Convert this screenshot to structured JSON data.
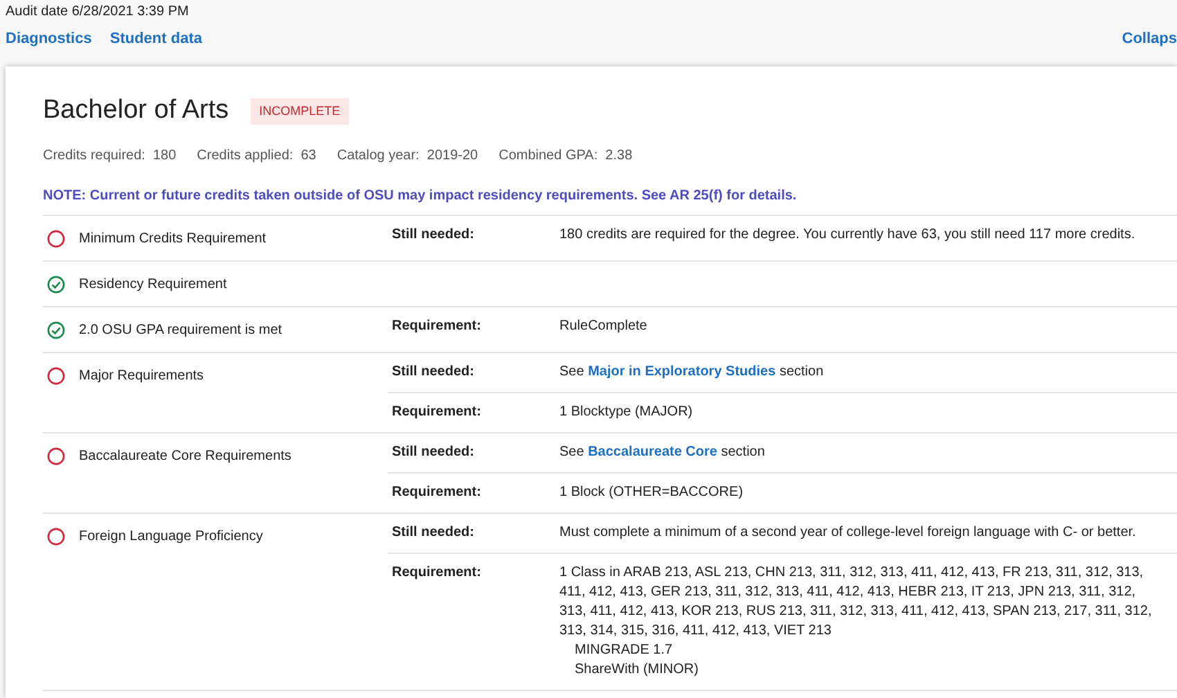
{
  "audit_date": {
    "label": "Audit date",
    "value": "6/28/2021 3:39 PM"
  },
  "links": [
    "Diagnostics",
    "Student data"
  ],
  "collapse_link": "Collaps",
  "degree": {
    "title": "Bachelor of Arts",
    "status": "INCOMPLETE"
  },
  "stats": [
    {
      "label": "Credits required:",
      "value": "180"
    },
    {
      "label": "Credits applied:",
      "value": "63"
    },
    {
      "label": "Catalog year:",
      "value": "2019-20"
    },
    {
      "label": "Combined GPA:",
      "value": "2.38"
    }
  ],
  "note": "NOTE: Current or future credits taken outside of OSU may impact residency requirements. See AR 25(f) for details.",
  "requirements": [
    {
      "name": "Minimum Credits Requirement",
      "kind": "incomplete",
      "details": [
        {
          "label": "Still needed:",
          "lines": [
            "180 credits are required for the degree. You currently have 63, you still need 117 more credits."
          ]
        }
      ]
    },
    {
      "name": "Residency Requirement",
      "kind": "complete"
    },
    {
      "name": "2.0 OSU GPA requirement is met",
      "kind": "complete",
      "details": [
        {
          "label": "Requirement:",
          "lines": [
            "RuleComplete"
          ]
        }
      ]
    },
    {
      "name": "Major Requirements",
      "kind": "incomplete",
      "details": [
        {
          "label": "Still needed:",
          "prefix": "See",
          "link": "Major in Exploratory Studies",
          "suffix": "section"
        },
        {
          "label": "Requirement:",
          "lines": [
            "1 Blocktype (MAJOR)"
          ]
        }
      ]
    },
    {
      "name": "Baccalaureate Core Requirements",
      "kind": "incomplete",
      "details": [
        {
          "label": "Still needed:",
          "prefix": "See",
          "link": "Baccalaureate Core",
          "suffix": "section"
        },
        {
          "label": "Requirement:",
          "lines": [
            "1 Block (OTHER=BACCORE)"
          ]
        }
      ]
    },
    {
      "name": "Foreign Language Proficiency",
      "kind": "incomplete",
      "details": [
        {
          "label": "Still needed:",
          "lines": [
            "Must complete a minimum of a second year of college-level foreign language with C- or better."
          ]
        },
        {
          "label": "Requirement:",
          "lines": [
            "1 Class in ARAB 213, ASL 213, CHN 213, 311, 312, 313, 411, 412, 413, FR 213, 311, 312, 313, 411, 412, 413, GER 213, 311, 312, 313, 411, 412, 413, HEBR 213, IT 213, JPN 213, 311, 312, 313, 411, 412, 413, KOR 213, RUS 213, 311, 312, 313, 411, 412, 413, SPAN 213, 217, 311, 312, 313, 314, 315, 316, 411, 412, 413, VIET 213"
          ],
          "sub_lines": [
            "MINGRADE 1.7",
            "ShareWith (MINOR)"
          ]
        }
      ]
    }
  ]
}
